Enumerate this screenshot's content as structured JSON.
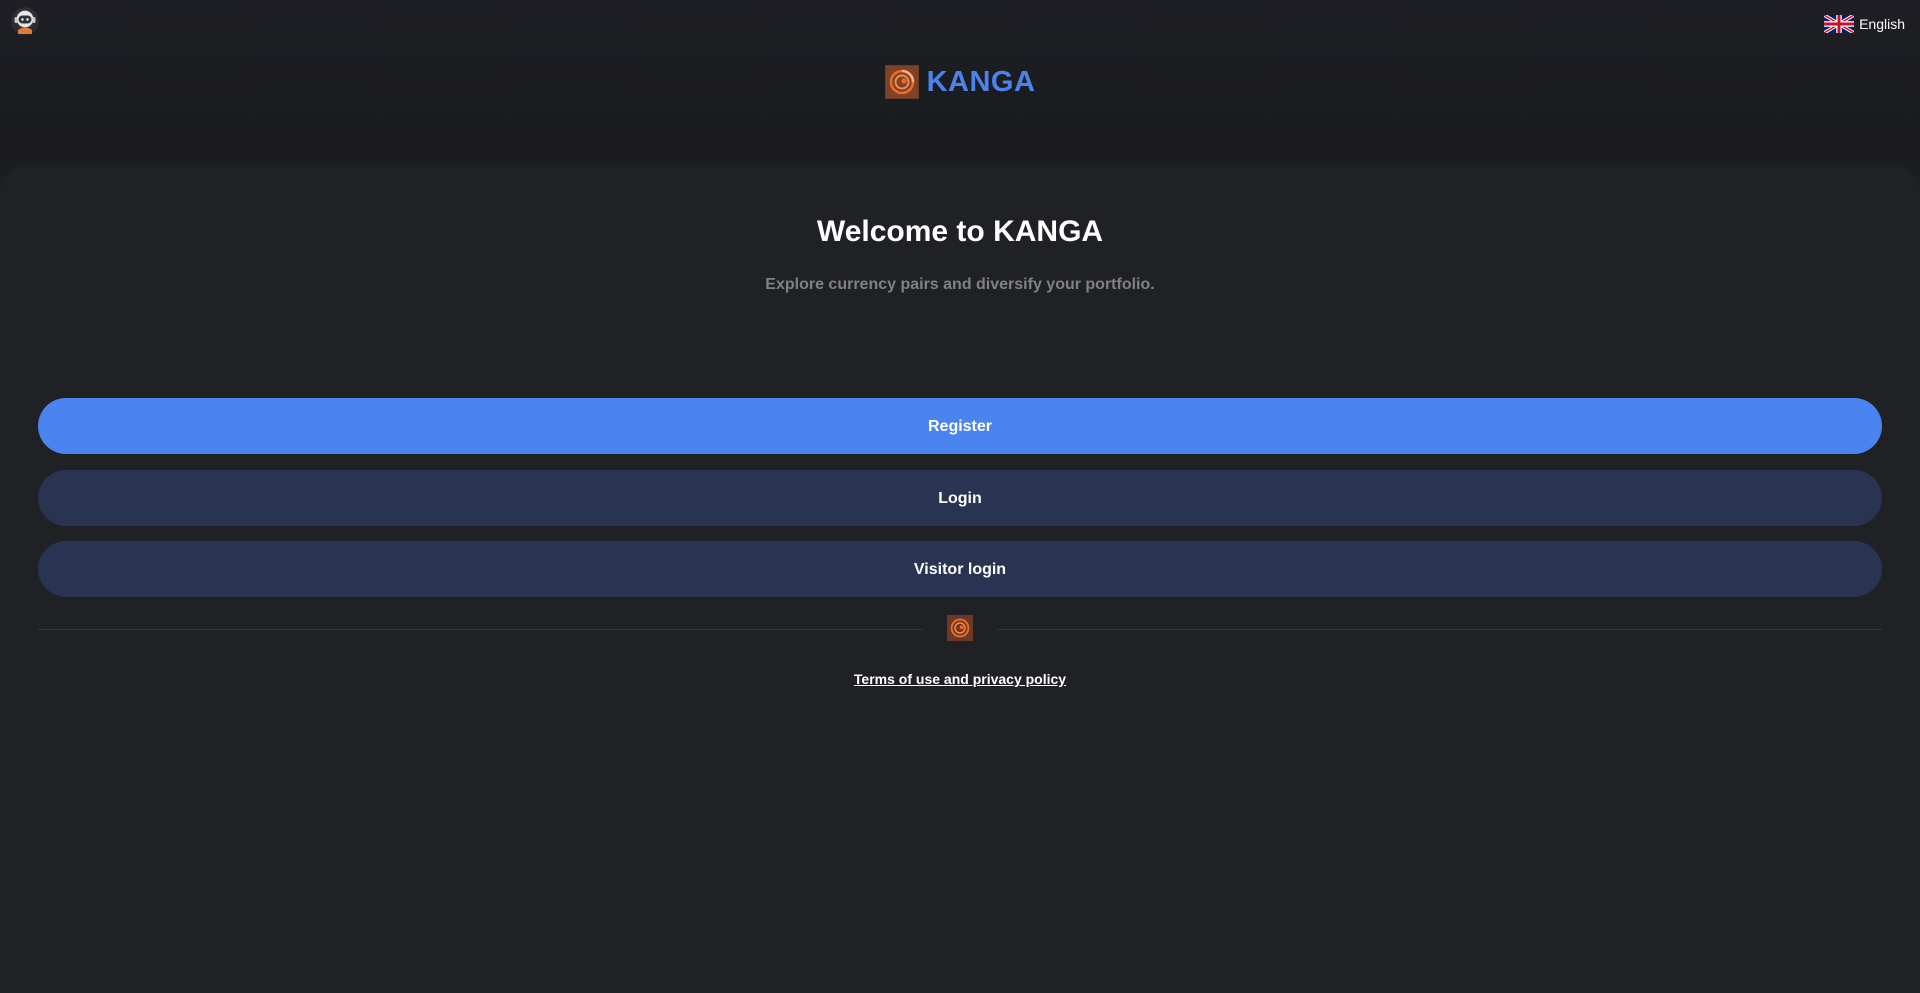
{
  "header": {
    "avatar_icon": "astronaut-avatar-icon",
    "language": {
      "label": "English",
      "flag_icon": "uk-flag-icon"
    }
  },
  "brand": {
    "name": "KANGA",
    "logo_icon": "kanga-logo-icon",
    "color": "#4b83ea"
  },
  "welcome": {
    "title": "Welcome to KANGA",
    "subtitle": "Explore currency pairs and diversify your portfolio."
  },
  "actions": {
    "register_label": "Register",
    "login_label": "Login",
    "visitor_login_label": "Visitor login"
  },
  "footer": {
    "terms_label": "Terms of use and privacy policy"
  },
  "colors": {
    "primary": "#4b84ee",
    "secondary": "#293452",
    "background": "#202125",
    "muted_text": "#808186"
  }
}
